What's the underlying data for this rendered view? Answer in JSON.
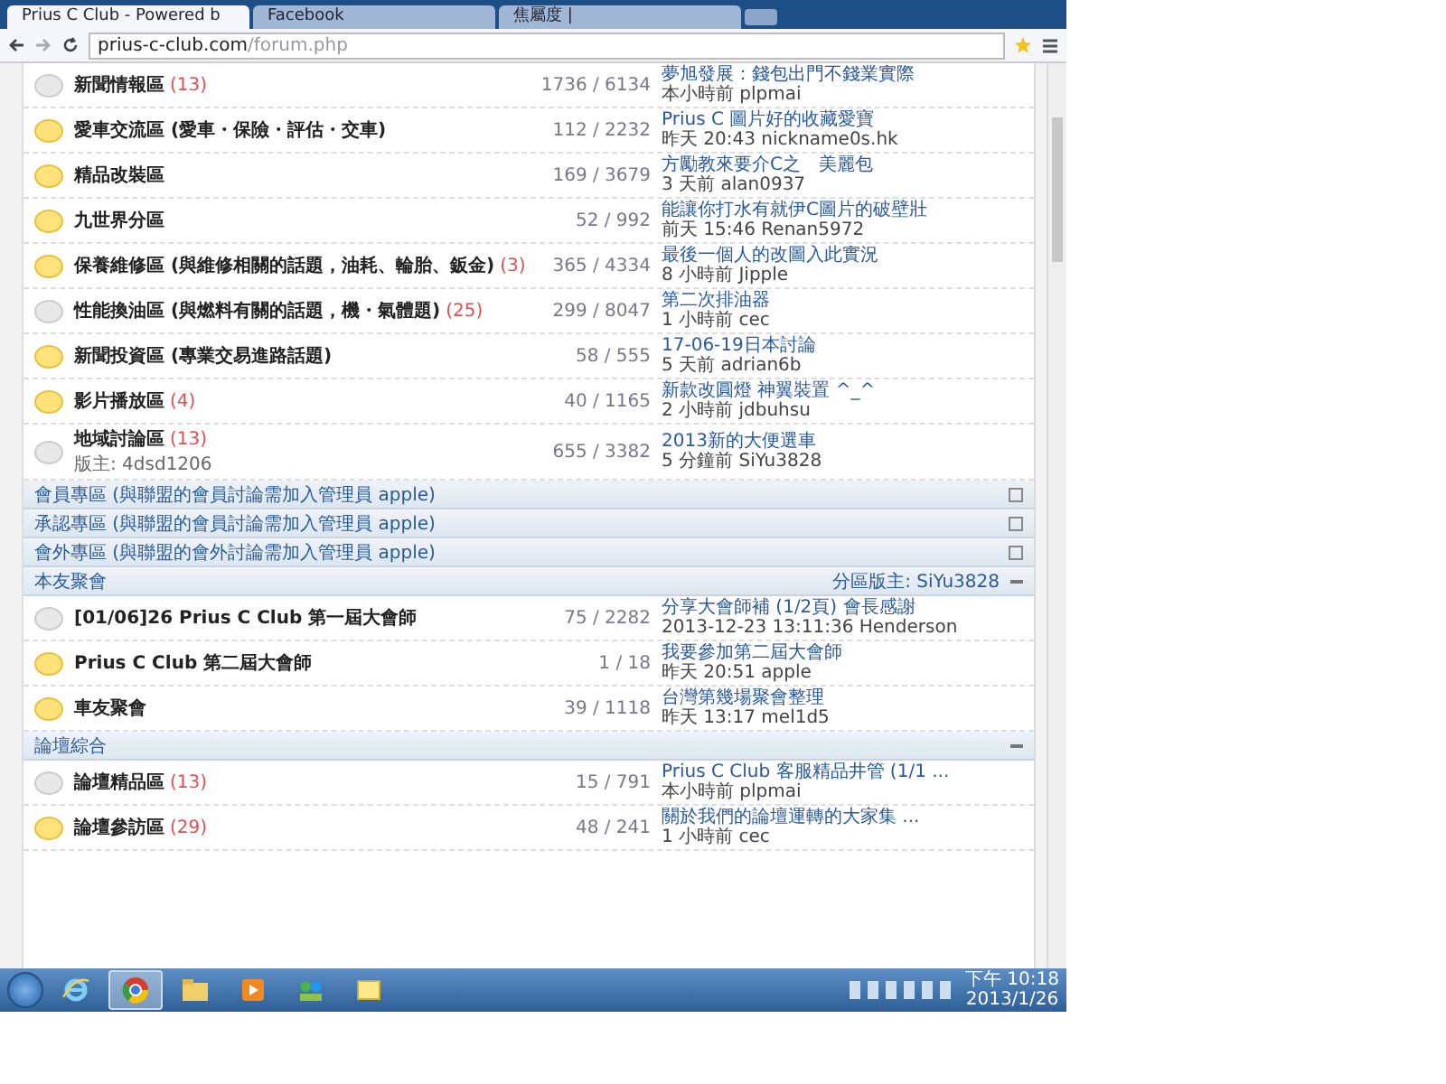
{
  "browser": {
    "tabs": [
      {
        "title": "Prius C Club - Powered b",
        "selected": true
      },
      {
        "title": "Facebook",
        "selected": false
      },
      {
        "title": "焦屬度 |",
        "selected": false
      }
    ],
    "address": {
      "host": "prius-c-club.com",
      "path": "/forum.php"
    }
  },
  "sections": [
    {
      "forums": [
        {
          "name": "新聞情報區",
          "today": "(13)",
          "new": false,
          "counts": "1736 / 6134",
          "last_post": "夢旭發展：錢包出門不錢業實際",
          "last_meta": "本小時前 plpmai"
        },
        {
          "name": "愛車交流區 (愛車・保險・評估・交車)",
          "new": true,
          "counts": "112 / 2232",
          "last_post": "Prius C 圖片好的收藏愛寶",
          "last_meta": "昨天 20:43 nickname0s.hk"
        },
        {
          "name": "精品改裝區",
          "new": true,
          "counts": "169 / 3679",
          "last_post": "方勵教來要介C之　美麗包",
          "last_meta": "3 天前 alan0937"
        },
        {
          "name": "九世界分區",
          "new": true,
          "counts": "52 / 992",
          "last_post": "能讓你打水有就伊C圖片的破壁壯",
          "last_meta": "前天 15:46 Renan5972"
        },
        {
          "name": "保養維修區 (與維修相關的話題，油耗、輪胎、鈑金)",
          "today": "(3)",
          "new": true,
          "counts": "365 / 4334",
          "last_post": "最後一個人的改圖入此實況",
          "last_meta": "8 小時前 Jipple"
        },
        {
          "name": "性能換油區 (與燃料有關的話題，機・氣體題)",
          "today": "(25)",
          "new": false,
          "counts": "299 / 8047",
          "last_post": "第二次排油器",
          "last_meta": "1 小時前 cec"
        },
        {
          "name": "新聞投資區 (專業交易進路話題)",
          "new": true,
          "counts": "58 / 555",
          "last_post": "17-06-19日本討論",
          "last_meta": "5 天前 adrian6b"
        },
        {
          "name": "影片播放區",
          "today": "(4)",
          "new": true,
          "counts": "40 / 1165",
          "last_post": "新款改圓燈 神翼裝置 ^_^",
          "last_meta": "2 小時前 jdbuhsu"
        },
        {
          "name": "地域討論區",
          "today": "(13)",
          "moderator": "版主: 4dsd1206",
          "new": false,
          "counts": "655 / 3382",
          "last_post": "2013新的大便選車",
          "last_meta": "5 分鐘前 SiYu3828"
        }
      ]
    },
    {
      "title": "會員專區 (與聯盟的會員討論需加入管理員 apple)",
      "collapsed": true
    },
    {
      "title": "承認專區 (與聯盟的會員討論需加入管理員 apple)",
      "collapsed": true
    },
    {
      "title": "會外專區 (與聯盟的會外討論需加入管理員 apple)",
      "collapsed": true
    },
    {
      "title": "本友聚會",
      "moderator": "分區版主: SiYu3828",
      "collapsed": false,
      "forums": [
        {
          "name": "[01/06]26 Prius C Club 第一屆大會師",
          "new": false,
          "counts": "75 / 2282",
          "last_post": "分享大會師補 (1/2頁) 會長感謝",
          "last_meta": "2013-12-23 13:11:36 Henderson"
        },
        {
          "name": "Prius C Club 第二屆大會師",
          "new": true,
          "counts": "1 / 18",
          "last_post": "我要參加第二屆大會師",
          "last_meta": "昨天 20:51 apple"
        },
        {
          "name": "車友聚會",
          "new": true,
          "counts": "39 / 1118",
          "last_post": "台灣第幾場聚會整理",
          "last_meta": "昨天 13:17 mel1d5"
        }
      ]
    },
    {
      "title": "論壇綜合",
      "collapsed": false,
      "forums": [
        {
          "name": "論壇精品區",
          "today": "(13)",
          "new": false,
          "counts": "15 / 791",
          "last_post": "Prius C Club 客服精品井管 (1/1 ...",
          "last_meta": "本小時前 plpmai"
        },
        {
          "name": "論壇參訪區",
          "today": "(29)",
          "new": true,
          "counts": "48 / 241",
          "last_post": "關於我們的論壇運轉的大家集 ...",
          "last_meta": "1 小時前 cec"
        }
      ]
    }
  ],
  "taskbar": {
    "apps": [
      {
        "kind": "ie",
        "selected": false
      },
      {
        "kind": "chrome",
        "selected": true
      },
      {
        "kind": "folder",
        "selected": false
      },
      {
        "kind": "media",
        "selected": false
      },
      {
        "kind": "network",
        "selected": false
      },
      {
        "kind": "notes",
        "selected": false
      }
    ],
    "clock": {
      "time": "下午 10:18",
      "date": "2013/1/26"
    }
  }
}
